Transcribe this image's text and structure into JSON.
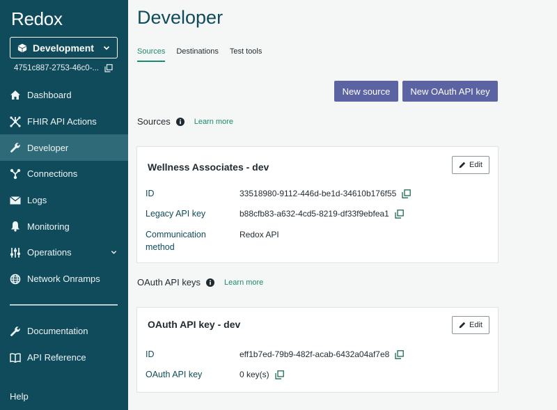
{
  "app": {
    "logo": "Redox"
  },
  "environment": {
    "selected": "Development",
    "id": "4751c887-2753-46c0-..."
  },
  "nav": {
    "items": [
      {
        "label": "Dashboard",
        "icon": "home-icon"
      },
      {
        "label": "FHIR API Actions",
        "icon": "fhir-icon"
      },
      {
        "label": "Developer",
        "icon": "wrench-icon",
        "active": true
      },
      {
        "label": "Connections",
        "icon": "connections-icon"
      },
      {
        "label": "Logs",
        "icon": "envelope-icon"
      },
      {
        "label": "Monitoring",
        "icon": "bell-icon"
      },
      {
        "label": "Operations",
        "icon": "sliders-icon"
      },
      {
        "label": "Network Onramps",
        "icon": "globe-icon"
      }
    ],
    "secondary": [
      {
        "label": "Documentation",
        "icon": "wrench-icon"
      },
      {
        "label": "API Reference",
        "icon": "book-icon"
      }
    ],
    "help": "Help"
  },
  "page": {
    "title": "Developer",
    "tabs": [
      "Sources",
      "Destinations",
      "Test tools"
    ],
    "active_tab": "Sources",
    "buttons": {
      "new_source": "New source",
      "new_oauth": "New OAuth API key"
    }
  },
  "sources": {
    "heading": "Sources",
    "learn_more": "Learn more",
    "card": {
      "title": "Wellness Associates - dev",
      "edit": "Edit",
      "id_label": "ID",
      "id_value": "33518980-9112-446d-be1d-34610b176f55",
      "legacy_label": "Legacy API key",
      "legacy_value": "b88cfb83-a632-4cd5-8219-df33f9ebfea1",
      "comm_label_1": "Communication",
      "comm_label_2": "method",
      "comm_value": "Redox API"
    }
  },
  "oauth": {
    "heading": "OAuth API keys",
    "learn_more": "Learn more",
    "card": {
      "title": "OAuth API key - dev",
      "edit": "Edit",
      "id_label": "ID",
      "id_value": "eff1b7ed-79b9-482f-acab-6432a04af7e8",
      "key_label": "OAuth API key",
      "key_value": "0 key(s)"
    }
  },
  "colors": {
    "sidebar": "#0f4b5b",
    "active_nav": "#2e6a78",
    "primary_button": "#5b63a3",
    "accent": "#1a8a6e"
  }
}
